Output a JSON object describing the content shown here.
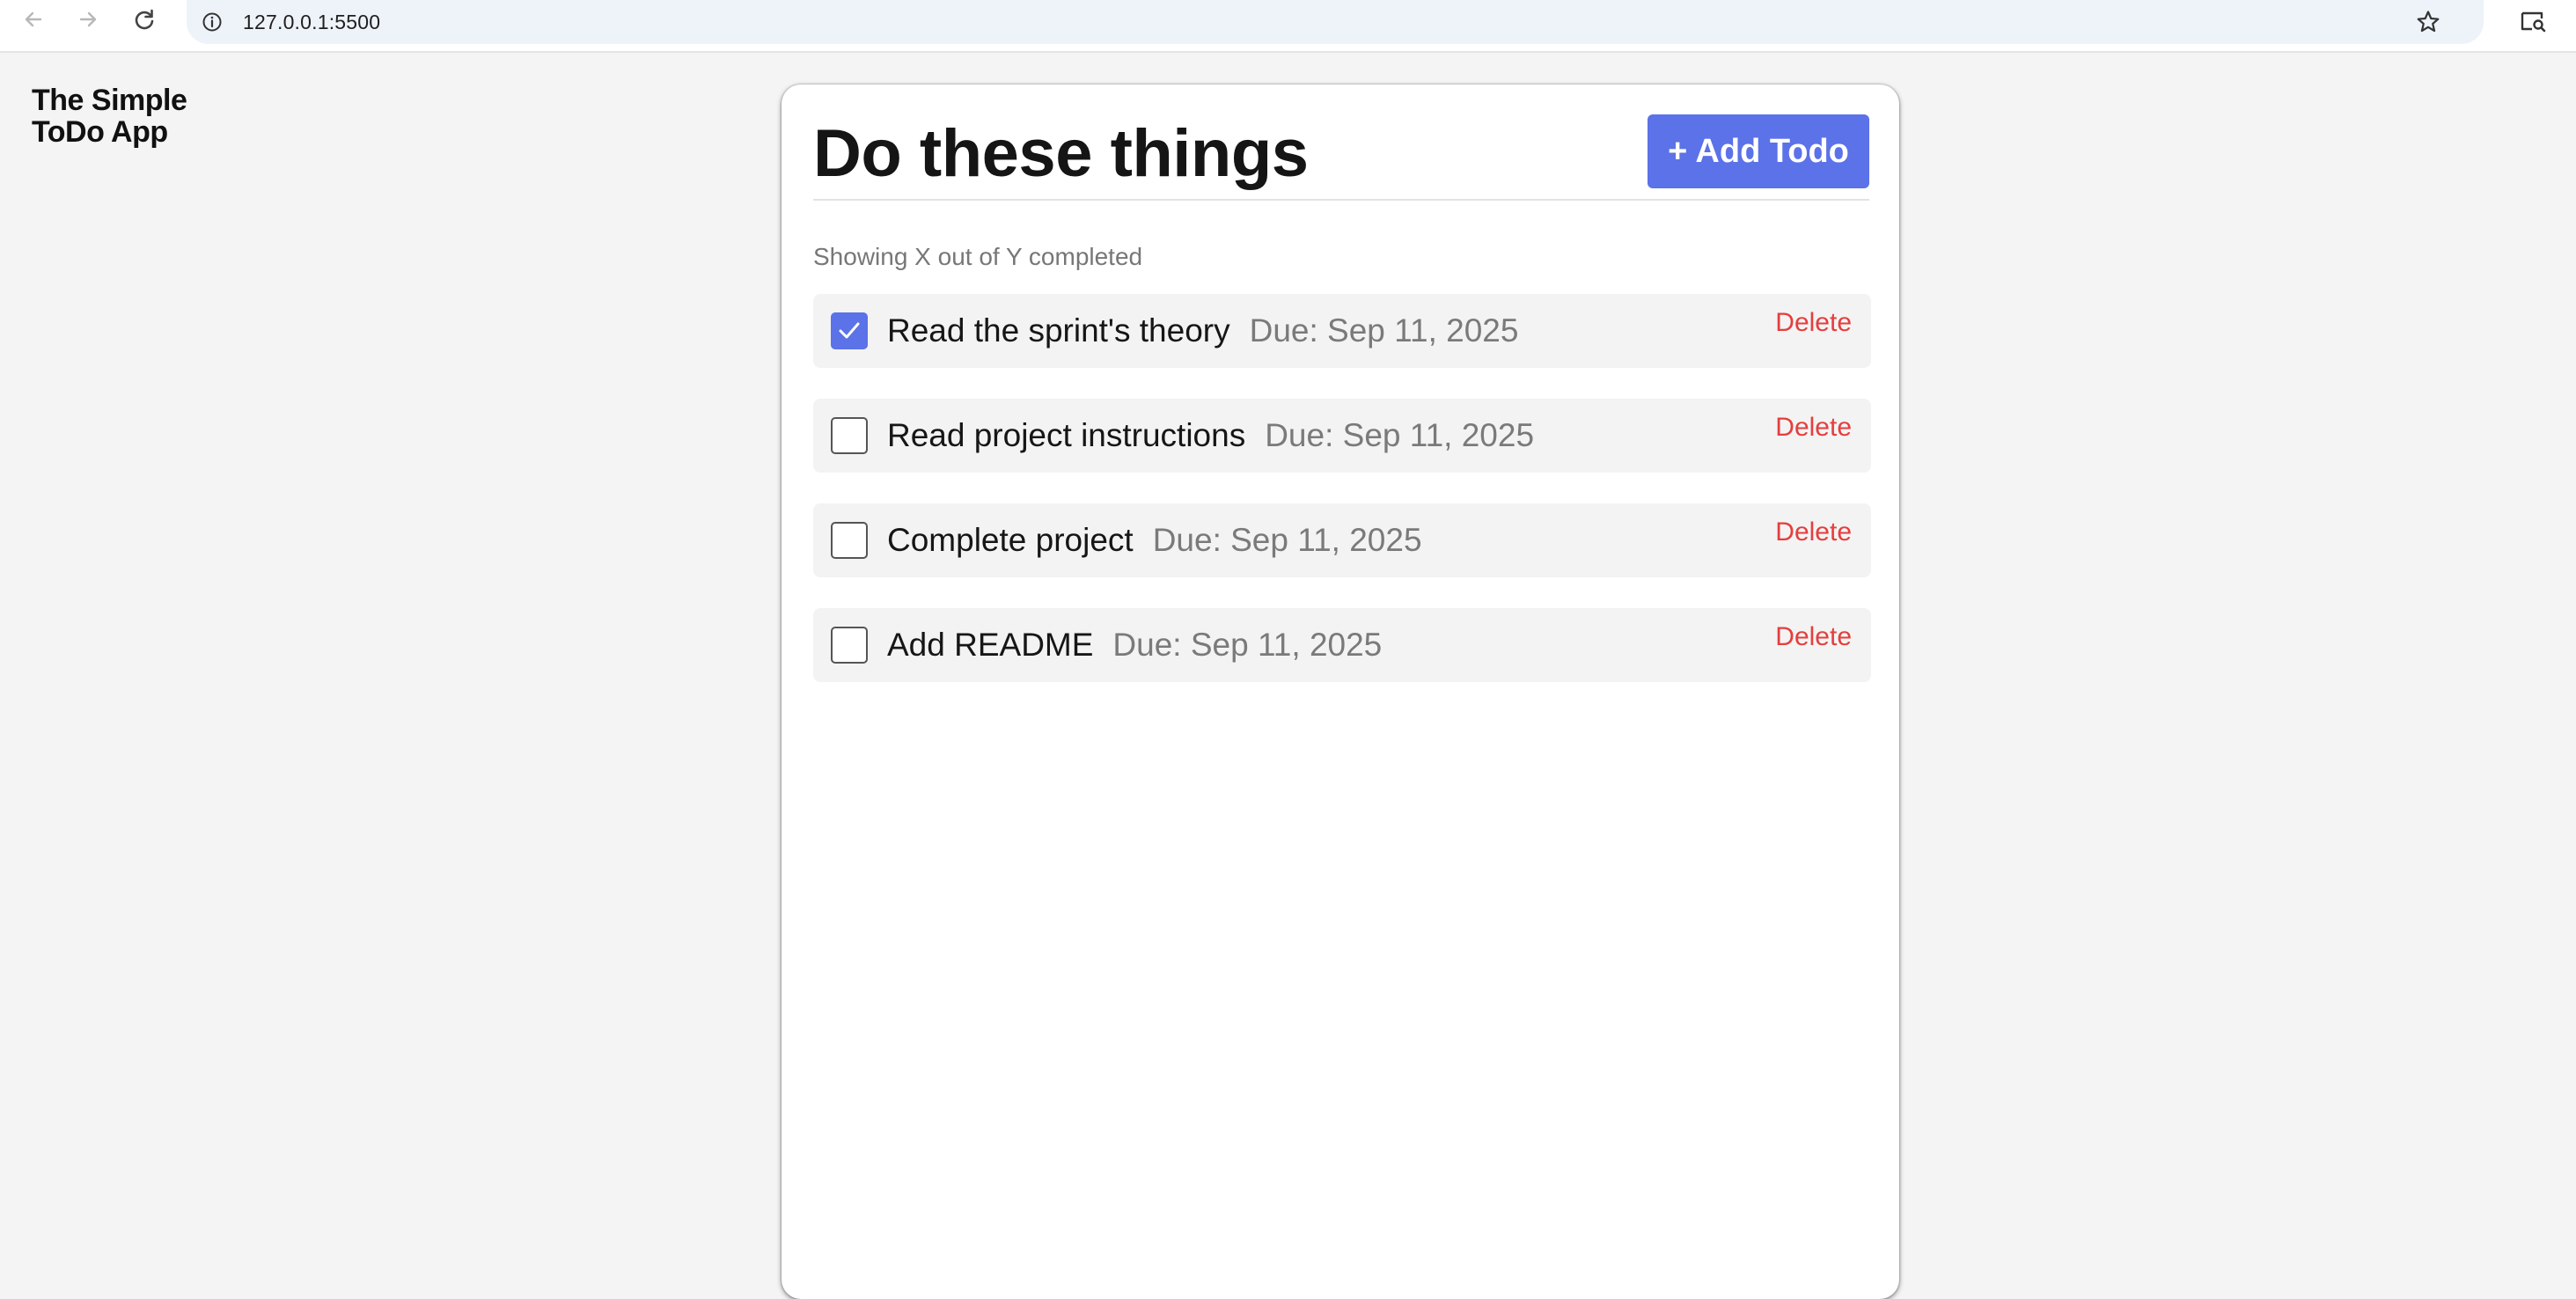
{
  "browser": {
    "url": "127.0.0.1:5500",
    "icons": [
      "back-arrow-icon",
      "forward-arrow-icon",
      "reload-icon",
      "site-info-icon",
      "bookmark-star-icon",
      "extension-search-icon"
    ]
  },
  "app": {
    "brand": "The Simple ToDo App",
    "title": "Do these things",
    "add_button_label": "+ Add Todo",
    "summary": "Showing X out of Y completed",
    "accent_color": "#5b72e8",
    "delete_color": "#e53e3e"
  },
  "todos": [
    {
      "title": "Read the sprint's theory",
      "due": "Due: Sep 11, 2025",
      "completed": true,
      "delete_label": "Delete"
    },
    {
      "title": "Read project instructions",
      "due": "Due: Sep 11, 2025",
      "completed": false,
      "delete_label": "Delete"
    },
    {
      "title": "Complete project",
      "due": "Due: Sep 11, 2025",
      "completed": false,
      "delete_label": "Delete"
    },
    {
      "title": "Add README",
      "due": "Due: Sep 11, 2025",
      "completed": false,
      "delete_label": "Delete"
    }
  ]
}
